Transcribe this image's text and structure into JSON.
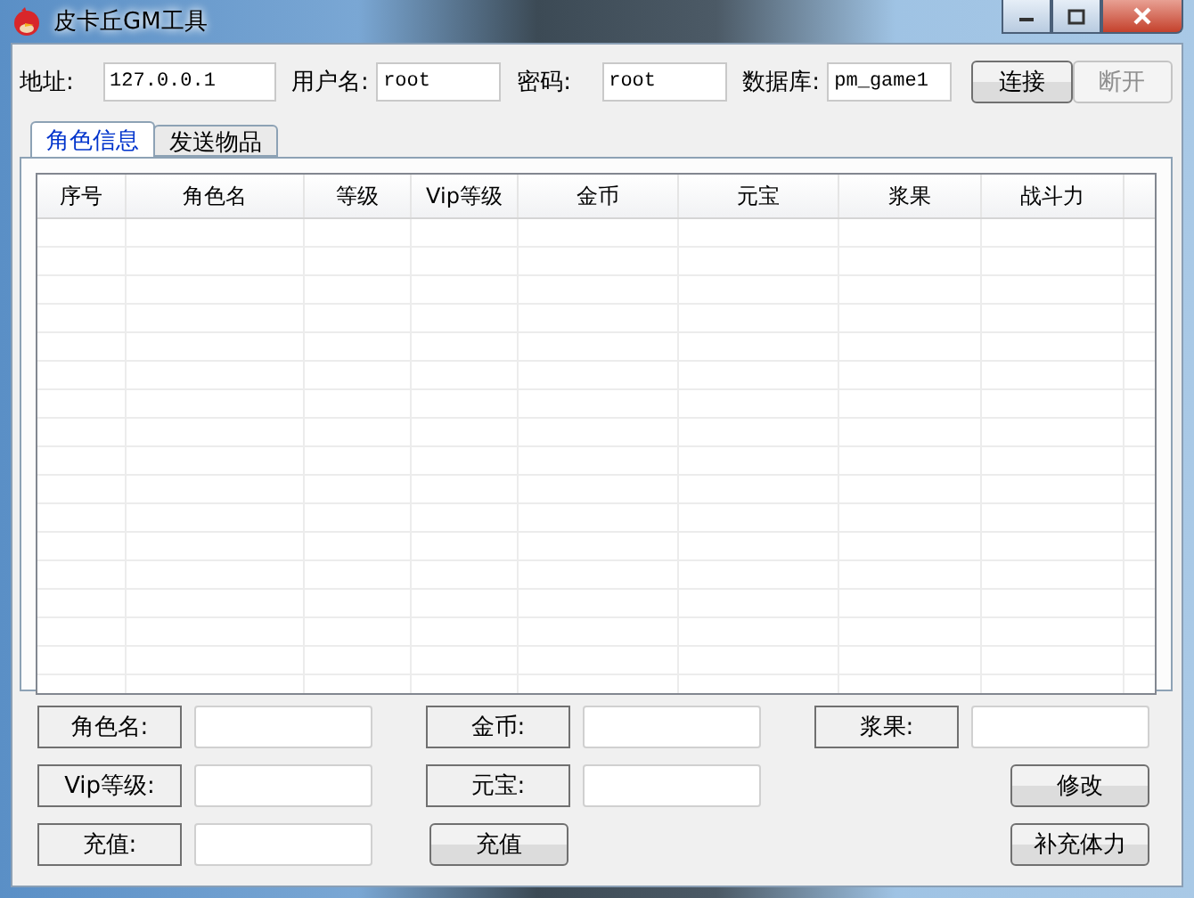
{
  "window": {
    "title": "皮卡丘GM工具"
  },
  "connection": {
    "fields": [
      {
        "label": "地址:",
        "value": "127.0.0.1"
      },
      {
        "label": "用户名:",
        "value": "root"
      },
      {
        "label": "密码:",
        "value": "root"
      },
      {
        "label": "数据库:",
        "value": "pm_game1"
      }
    ],
    "buttons": [
      {
        "label": "连接",
        "disabled": false
      },
      {
        "label": "断开",
        "disabled": true
      }
    ]
  },
  "tabs": [
    {
      "label": "角色信息",
      "selected": true
    },
    {
      "label": "发送物品",
      "selected": false
    }
  ],
  "table": {
    "columns": [
      "序号",
      "角色名",
      "等级",
      "Vip等级",
      "金币",
      "元宝",
      "浆果",
      "战斗力"
    ]
  },
  "editor": {
    "rows": [
      [
        {
          "kind": "field",
          "label": "角色名:"
        },
        {
          "kind": "field",
          "label": "金币:"
        },
        {
          "kind": "field",
          "label": "浆果:"
        }
      ],
      [
        {
          "kind": "field",
          "label": "Vip等级:"
        },
        {
          "kind": "field",
          "label": "元宝:"
        },
        {
          "kind": "button",
          "label": "修改"
        }
      ],
      [
        {
          "kind": "field",
          "label": "充值:"
        },
        {
          "kind": "button",
          "label": "充值"
        },
        {
          "kind": "button",
          "label": "补充体力"
        }
      ]
    ]
  }
}
